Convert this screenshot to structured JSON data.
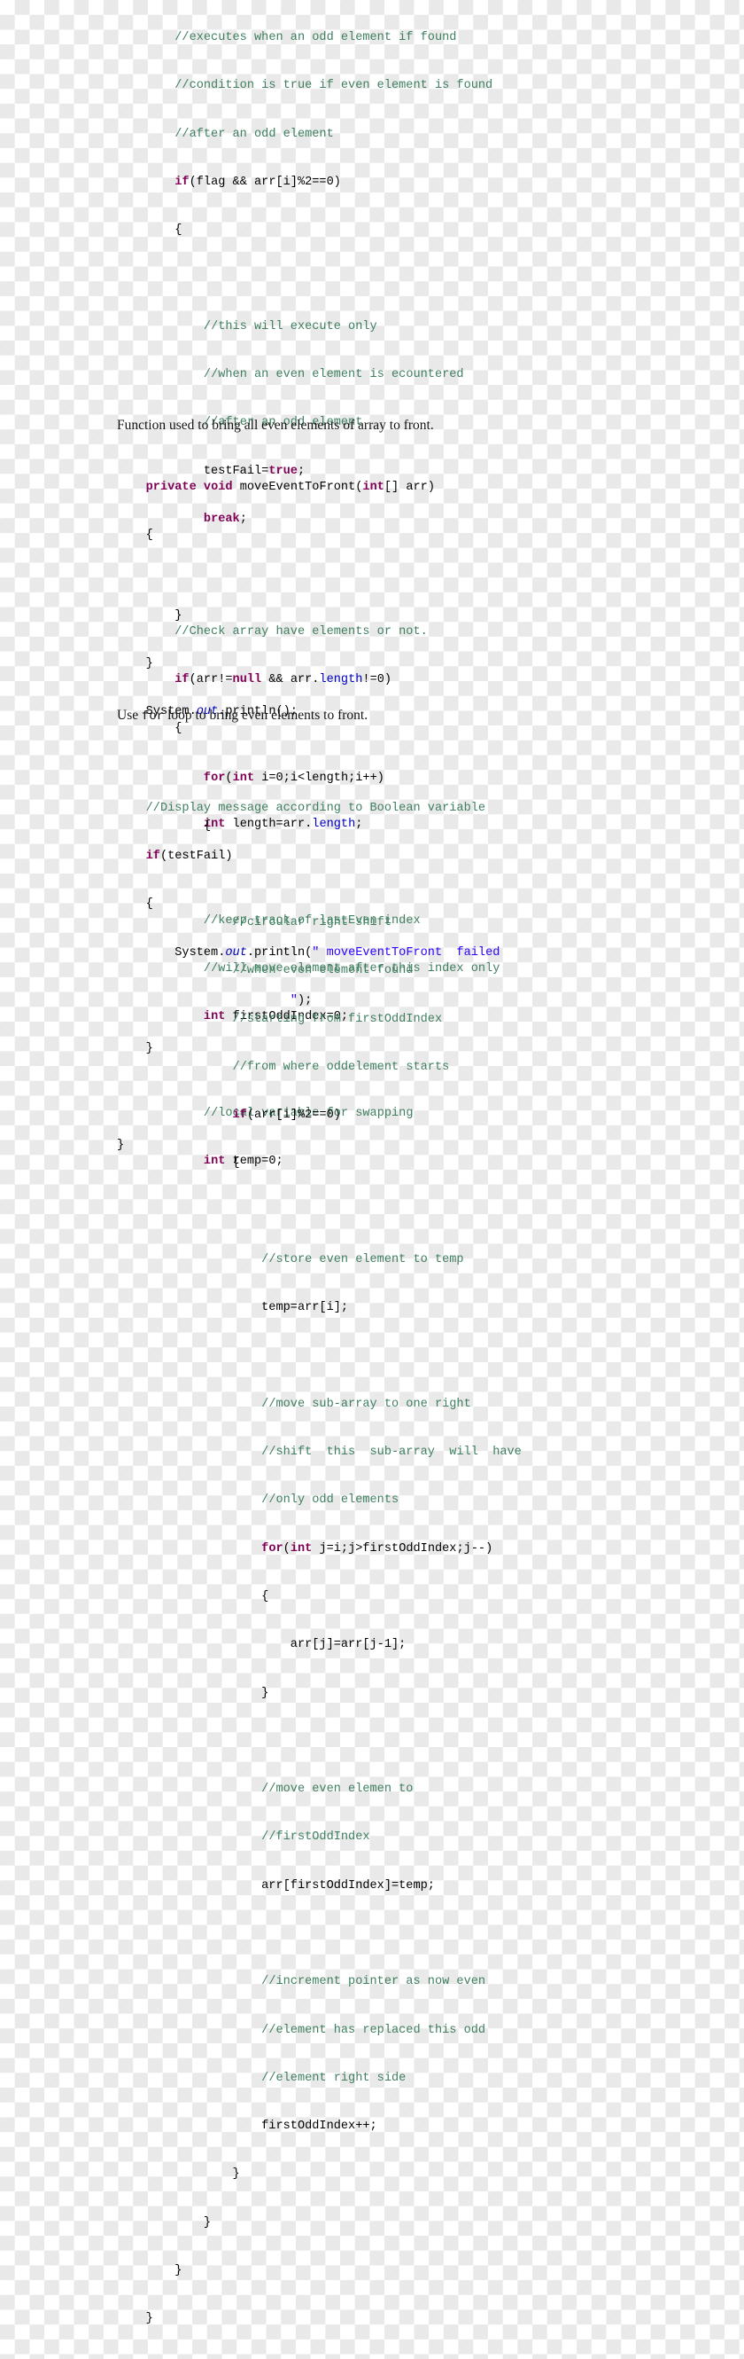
{
  "document": {
    "kind": "java-code-listing",
    "language": "Java",
    "colors": {
      "comment": "#3f7f5f",
      "keyword": "#7f0055",
      "string": "#2a00ff",
      "field": "#0000c0",
      "text": "#000000",
      "prose": "#121212",
      "checker_light": "#ffffff",
      "checker_dark": "#e9e9e9"
    },
    "code_block_1": {
      "lines": [
        "        //executes when an odd element if found",
        "        //condition is true if even element is found",
        "        //after an odd element",
        "        if(flag && arr[i]%2==0)",
        "        {",
        "",
        "            //this will execute only",
        "            //when an even element is ecountered",
        "            //after an odd element",
        "            testFail=true;",
        "            break;",
        "",
        "        }",
        "    }",
        "    System.out.println();",
        "",
        "    //Display message according to Boolean variable",
        "    if(testFail)",
        "    {",
        "        System.out.println(\" moveEventToFront  failed",
        "                        \");",
        "    }",
        "",
        "}"
      ]
    },
    "paragraph_1": {
      "text": "Function used to bring all even elements of array to front."
    },
    "code_block_2": {
      "lines": [
        "    private void moveEventToFront(int[] arr)",
        "    {",
        "",
        "        //Check array have elements or not.",
        "        if(arr!=null && arr.length!=0)",
        "        {",
        "",
        "            int length=arr.length;",
        "",
        "            //keep track of lastEven index",
        "            //will move element after this index only",
        "            int firstOddIndex=0;",
        "",
        "            //local variable for swapping",
        "            int temp=0;"
      ]
    },
    "paragraph_2": {
      "prefix": "Use ",
      "mono": "for",
      "suffix": " loop to bring even elements to front."
    },
    "code_block_3": {
      "lines": [
        "            for(int i=0;i<length;i++)",
        "            {",
        "",
        "                //circular right shift",
        "                //when even element found",
        "                //starting from firstOddIndex",
        "                //from where oddelement starts",
        "                if(arr[i]%2==0)",
        "                {",
        "",
        "                    //store even element to temp",
        "                    temp=arr[i];",
        "",
        "                    //move sub-array to one right",
        "                    //shift  this  sub-array  will  have",
        "                    //only odd elements",
        "                    for(int j=i;j>firstOddIndex;j--)",
        "                    {",
        "                        arr[j]=arr[j-1];",
        "                    }",
        "",
        "                    //move even elemen to",
        "                    //firstOddIndex",
        "                    arr[firstOddIndex]=temp;",
        "",
        "                    //increment pointer as now even",
        "                    //element has replaced this odd",
        "                    //element right side",
        "                    firstOddIndex++;",
        "                }",
        "            }",
        "        }",
        "    }"
      ]
    }
  }
}
